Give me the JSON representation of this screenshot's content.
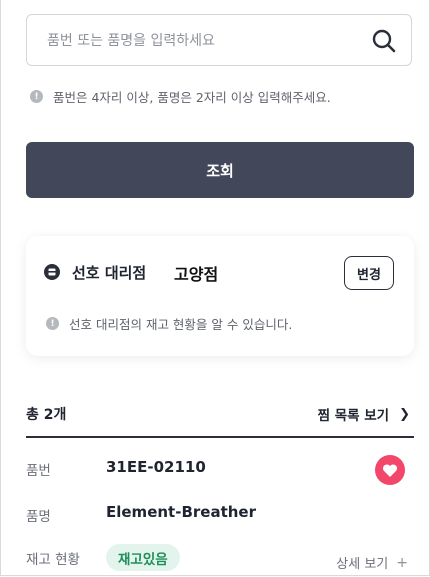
{
  "search": {
    "placeholder": "품번 또는 품명을 입력하세요",
    "hint": "품번은 4자리 이상, 품명은 2자리 이상 입력해주세요.",
    "button_label": "조회",
    "icon": "search-icon"
  },
  "store": {
    "label": "선호 대리점",
    "name": "고양점",
    "change_label": "변경",
    "hint": "선호 대리점의 재고 현황을 알 수 있습니다.",
    "icon": "store-icon"
  },
  "results": {
    "total": "총 2개",
    "wishlist_link": "찜 목록 보기",
    "items": [
      {
        "part_no_label": "품번",
        "part_no": "31EE-02110",
        "name_label": "품명",
        "name": "Element-Breather",
        "stock_label": "재고 현황",
        "stock_status": "재고있음",
        "detail_link": "상세 보기",
        "favorited": true
      }
    ]
  },
  "colors": {
    "primary_button": "#424759",
    "heart": "#f2476a",
    "in_stock_bg": "#e3f4ec",
    "in_stock_text": "#1f8e5a"
  }
}
